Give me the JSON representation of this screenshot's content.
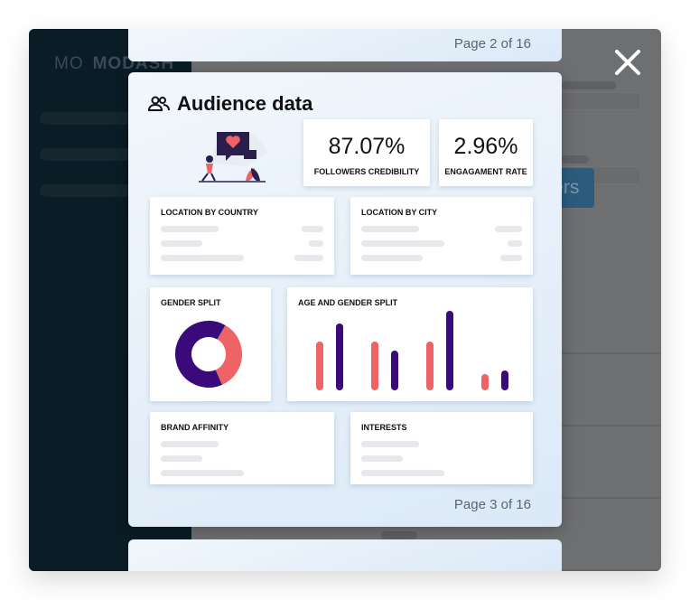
{
  "app": {
    "logo_mark": "MO",
    "logo_text": "MODASH"
  },
  "background": {
    "cta_label": "ncers"
  },
  "pages": {
    "prev_label": "Page 2 of 16",
    "current_label": "Page 3 of 16"
  },
  "report": {
    "title": "Audience data",
    "stats": [
      {
        "value": "87.07%",
        "label": "FOLLOWERS CREDIBILITY"
      },
      {
        "value": "2.96%",
        "label": "ENGAGAMENT RATE"
      }
    ],
    "sections": {
      "location_country": "LOCATION BY COUNTRY",
      "location_city": "LOCATION BY CITY",
      "gender_split": "GENDER SPLIT",
      "age_gender": "AGE AND GENDER SPLIT",
      "brand_affinity": "BRAND AFFINITY",
      "interests": "INTERESTS"
    }
  },
  "chart_data": [
    {
      "type": "pie",
      "title": "GENDER SPLIT",
      "values": [
        35,
        65
      ],
      "colors": [
        "#ee6466",
        "#3b0a7a"
      ]
    },
    {
      "type": "bar",
      "title": "AGE AND GENDER SPLIT",
      "categories": [
        "",
        "",
        "",
        ""
      ],
      "series": [
        {
          "values": [
            54,
            54,
            54,
            18
          ],
          "color": "#ee6466"
        },
        {
          "values": [
            74,
            44,
            88,
            22
          ],
          "color": "#3b0a7a"
        }
      ],
      "ylim": [
        0,
        90
      ]
    }
  ]
}
